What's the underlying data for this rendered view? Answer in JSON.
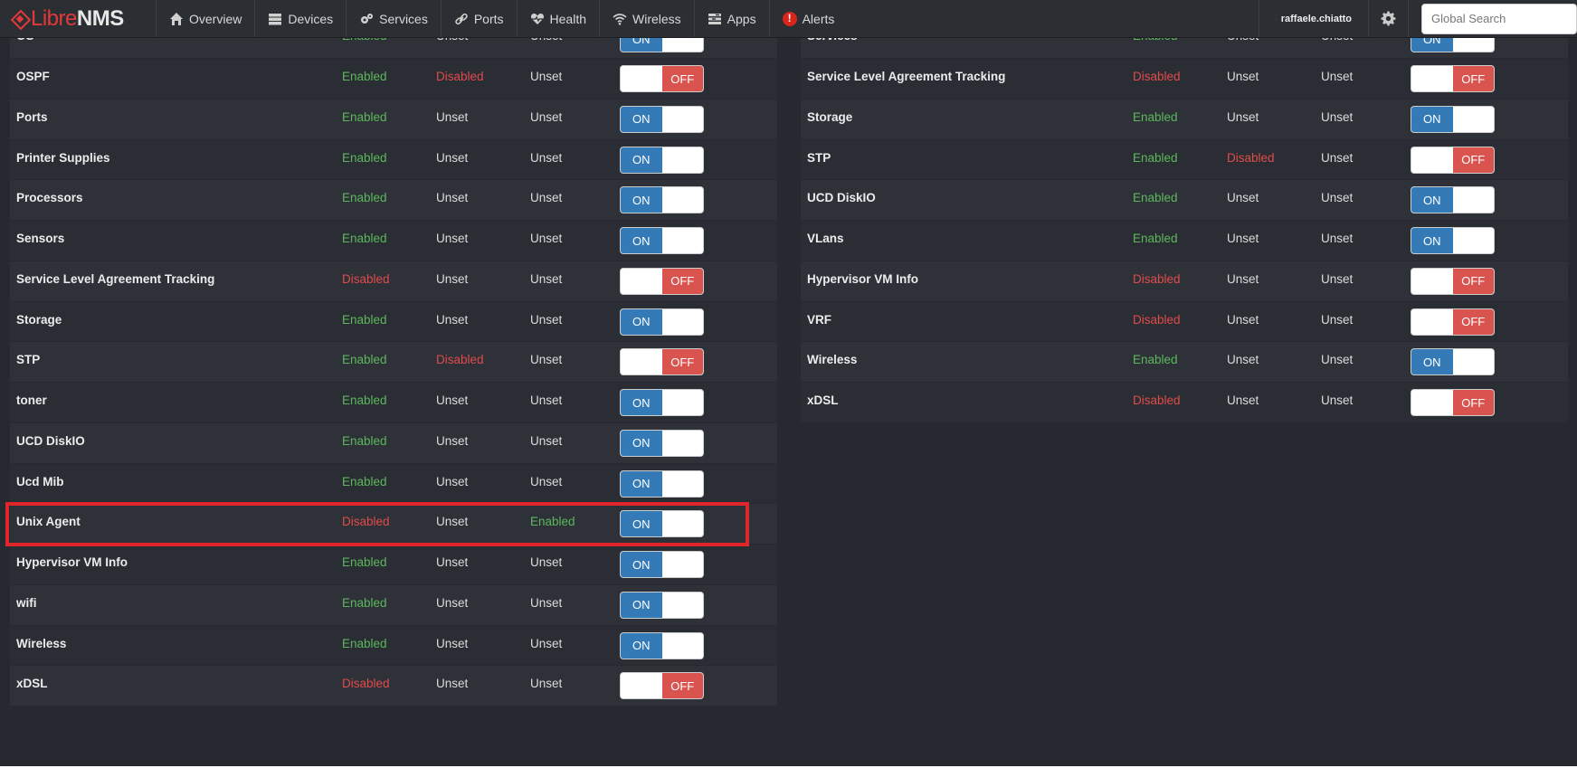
{
  "brand": {
    "part1": "Libre",
    "part2": "NMS"
  },
  "nav": [
    {
      "icon": "home-icon",
      "label": "Overview"
    },
    {
      "icon": "server-icon",
      "label": "Devices"
    },
    {
      "icon": "cogs-icon",
      "label": "Services"
    },
    {
      "icon": "link-icon",
      "label": "Ports"
    },
    {
      "icon": "heartbeat-icon",
      "label": "Health"
    },
    {
      "icon": "wifi-icon",
      "label": "Wireless"
    },
    {
      "icon": "tasks-icon",
      "label": "Apps"
    },
    {
      "icon": "alert-icon",
      "label": "Alerts"
    }
  ],
  "user": {
    "name": "raffaele.chiatto",
    "icon": "user-icon"
  },
  "settings": {
    "icon": "gear-icon"
  },
  "search": {
    "placeholder": "Global Search",
    "value": ""
  },
  "colors": {
    "enabled": "#5cb85c",
    "disabled": "#e04b4b",
    "on": "#337ab7",
    "off": "#d9534f",
    "highlight": "#e0262b"
  },
  "modules_left": [
    {
      "name": "OS",
      "global": "Enabled",
      "os": "Unset",
      "device": "Unset",
      "toggle": "ON"
    },
    {
      "name": "OSPF",
      "global": "Enabled",
      "os": "Disabled",
      "device": "Unset",
      "toggle": "OFF"
    },
    {
      "name": "Ports",
      "global": "Enabled",
      "os": "Unset",
      "device": "Unset",
      "toggle": "ON"
    },
    {
      "name": "Printer Supplies",
      "global": "Enabled",
      "os": "Unset",
      "device": "Unset",
      "toggle": "ON"
    },
    {
      "name": "Processors",
      "global": "Enabled",
      "os": "Unset",
      "device": "Unset",
      "toggle": "ON"
    },
    {
      "name": "Sensors",
      "global": "Enabled",
      "os": "Unset",
      "device": "Unset",
      "toggle": "ON"
    },
    {
      "name": "Service Level Agreement Tracking",
      "global": "Disabled",
      "os": "Unset",
      "device": "Unset",
      "toggle": "OFF"
    },
    {
      "name": "Storage",
      "global": "Enabled",
      "os": "Unset",
      "device": "Unset",
      "toggle": "ON"
    },
    {
      "name": "STP",
      "global": "Enabled",
      "os": "Disabled",
      "device": "Unset",
      "toggle": "OFF"
    },
    {
      "name": "toner",
      "global": "Enabled",
      "os": "Unset",
      "device": "Unset",
      "toggle": "ON"
    },
    {
      "name": "UCD DiskIO",
      "global": "Enabled",
      "os": "Unset",
      "device": "Unset",
      "toggle": "ON"
    },
    {
      "name": "Ucd Mib",
      "global": "Enabled",
      "os": "Unset",
      "device": "Unset",
      "toggle": "ON"
    },
    {
      "name": "Unix Agent",
      "global": "Disabled",
      "os": "Unset",
      "device": "Enabled",
      "toggle": "ON",
      "highlighted": true
    },
    {
      "name": "Hypervisor VM Info",
      "global": "Enabled",
      "os": "Unset",
      "device": "Unset",
      "toggle": "ON"
    },
    {
      "name": "wifi",
      "global": "Enabled",
      "os": "Unset",
      "device": "Unset",
      "toggle": "ON"
    },
    {
      "name": "Wireless",
      "global": "Enabled",
      "os": "Unset",
      "device": "Unset",
      "toggle": "ON"
    },
    {
      "name": "xDSL",
      "global": "Disabled",
      "os": "Unset",
      "device": "Unset",
      "toggle": "OFF"
    }
  ],
  "modules_right": [
    {
      "name": "Services",
      "global": "Enabled",
      "os": "Unset",
      "device": "Unset",
      "toggle": "ON"
    },
    {
      "name": "Service Level Agreement Tracking",
      "global": "Disabled",
      "os": "Unset",
      "device": "Unset",
      "toggle": "OFF"
    },
    {
      "name": "Storage",
      "global": "Enabled",
      "os": "Unset",
      "device": "Unset",
      "toggle": "ON"
    },
    {
      "name": "STP",
      "global": "Enabled",
      "os": "Disabled",
      "device": "Unset",
      "toggle": "OFF"
    },
    {
      "name": "UCD DiskIO",
      "global": "Enabled",
      "os": "Unset",
      "device": "Unset",
      "toggle": "ON"
    },
    {
      "name": "VLans",
      "global": "Enabled",
      "os": "Unset",
      "device": "Unset",
      "toggle": "ON"
    },
    {
      "name": "Hypervisor VM Info",
      "global": "Disabled",
      "os": "Unset",
      "device": "Unset",
      "toggle": "OFF"
    },
    {
      "name": "VRF",
      "global": "Disabled",
      "os": "Unset",
      "device": "Unset",
      "toggle": "OFF"
    },
    {
      "name": "Wireless",
      "global": "Enabled",
      "os": "Unset",
      "device": "Unset",
      "toggle": "ON"
    },
    {
      "name": "xDSL",
      "global": "Disabled",
      "os": "Unset",
      "device": "Unset",
      "toggle": "OFF"
    }
  ]
}
